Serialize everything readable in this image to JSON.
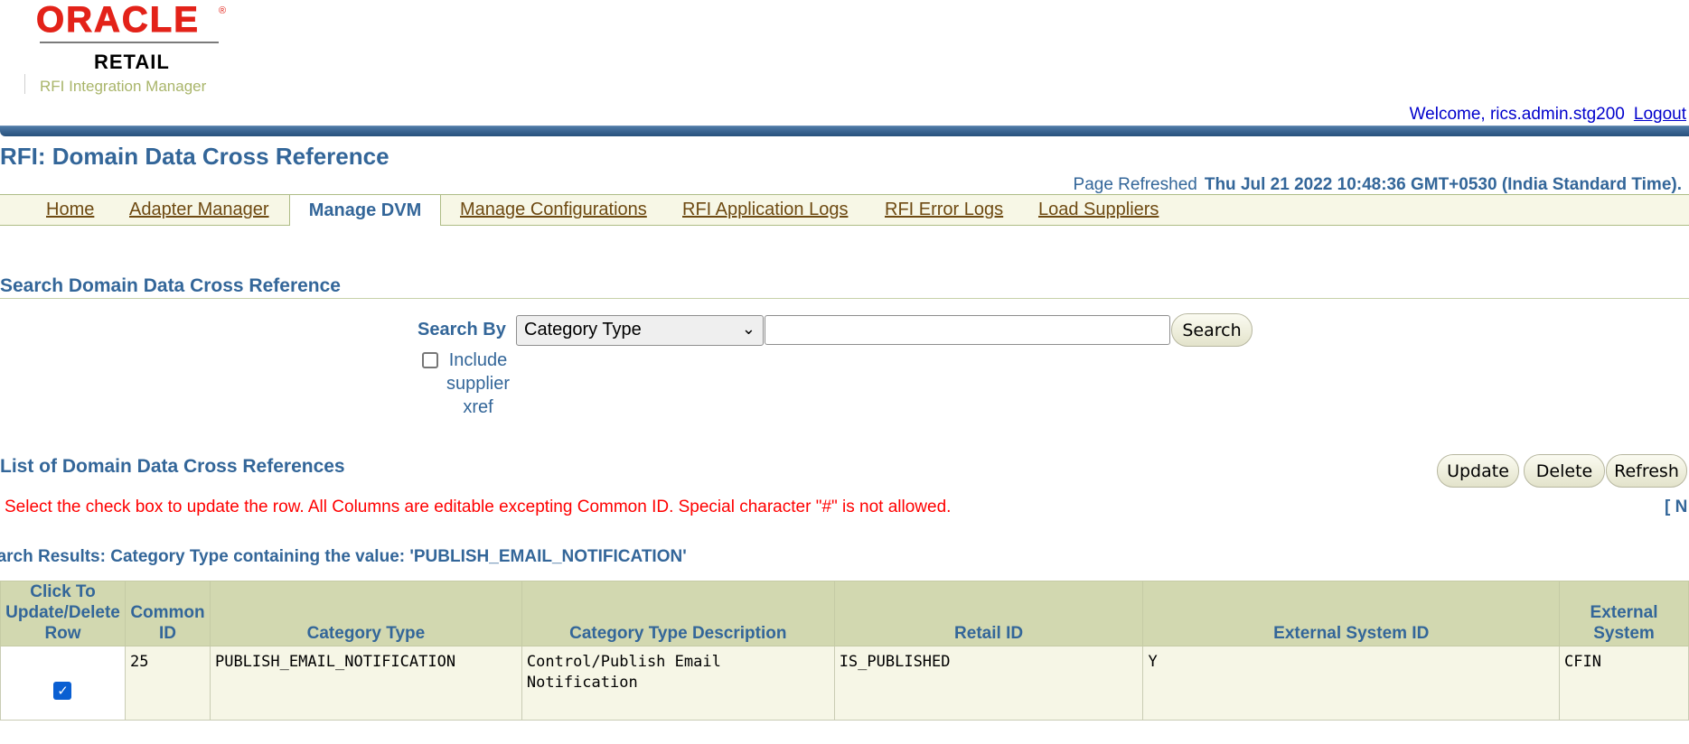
{
  "logo": {
    "brand": "ORACLE",
    "registered": "®",
    "product_line": "RETAIL",
    "product_name": "RFI Integration Manager"
  },
  "user": {
    "welcome": "Welcome, rics.admin.stg200",
    "logout": "Logout"
  },
  "page": {
    "title": "RFI: Domain Data Cross Reference",
    "refreshed_label": "Page Refreshed",
    "refreshed_value": "Thu Jul 21 2022 10:48:36 GMT+0530 (India Standard Time)."
  },
  "tabs": [
    {
      "label": "Home",
      "active": false
    },
    {
      "label": "Adapter Manager",
      "active": false
    },
    {
      "label": "Manage DVM",
      "active": true
    },
    {
      "label": "Manage Configurations",
      "active": false
    },
    {
      "label": "RFI Application Logs",
      "active": false
    },
    {
      "label": "RFI Error Logs",
      "active": false
    },
    {
      "label": "Load Suppliers",
      "active": false
    }
  ],
  "search": {
    "header": "Search Domain Data Cross Reference",
    "search_by_label": "Search By",
    "search_by_value": "Category Type",
    "search_value": "",
    "search_button": "Search",
    "include_label": "Include supplier xref",
    "include_checked": false
  },
  "list": {
    "header": "List of Domain Data Cross References",
    "buttons": {
      "update": "Update",
      "delete": "Delete",
      "refresh": "Refresh"
    },
    "instruction": "Select the check box to update the row. All Columns are editable excepting Common ID. Special character \"#\" is not allowed.",
    "nav": "[ N",
    "results_caption": "earch Results: Category Type containing the value: 'PUBLISH_EMAIL_NOTIFICATION'"
  },
  "table": {
    "columns": [
      "Click To Update/Delete Row",
      "Common ID",
      "Category Type",
      "Category Type Description",
      "Retail ID",
      "External System ID",
      "External System"
    ],
    "rows": [
      {
        "selected": true,
        "common_id": "25",
        "category_type": "PUBLISH_EMAIL_NOTIFICATION",
        "description": "Control/Publish Email Notification",
        "retail_id": "IS_PUBLISHED",
        "external_system_id": "Y",
        "external_system": "CFIN"
      }
    ]
  },
  "colors": {
    "brand_red": "#e32219",
    "heading_blue": "#336699",
    "header_bar": "#27507c",
    "table_header_bg": "#d2d8b0",
    "error_red": "#ff0000"
  }
}
